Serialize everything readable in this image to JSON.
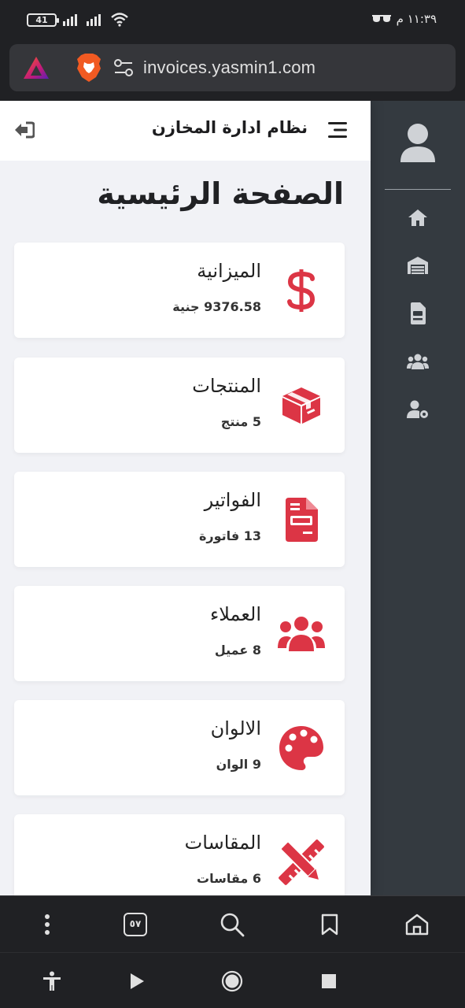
{
  "status_bar": {
    "battery": "41",
    "time": "١١:٣٩ م"
  },
  "browser": {
    "url": "invoices.yasmin1.com",
    "tab_count": "٥٧"
  },
  "header": {
    "app_title": "نظام ادارة المخازن"
  },
  "main": {
    "page_title": "الصفحة الرئيسية",
    "cards": [
      {
        "title": "الميزانية",
        "value": "9376.58 جنية",
        "icon": "dollar-icon"
      },
      {
        "title": "المنتجات",
        "value": "5 منتج",
        "icon": "box-icon"
      },
      {
        "title": "الفواتير",
        "value": "13 فاتورة",
        "icon": "invoice-icon"
      },
      {
        "title": "العملاء",
        "value": "8 عميل",
        "icon": "users-icon"
      },
      {
        "title": "الالوان",
        "value": "9 الوان",
        "icon": "palette-icon"
      },
      {
        "title": "المقاسات",
        "value": "6 مقاسات",
        "icon": "ruler-pencil-icon"
      }
    ]
  },
  "sidebar": {
    "items": [
      "home-icon",
      "warehouse-icon",
      "file-invoice-icon",
      "users-icon",
      "user-gear-icon"
    ]
  },
  "colors": {
    "accent": "#dc3545",
    "sidebar_bg": "#343a40",
    "page_bg": "#f1f2f6"
  }
}
